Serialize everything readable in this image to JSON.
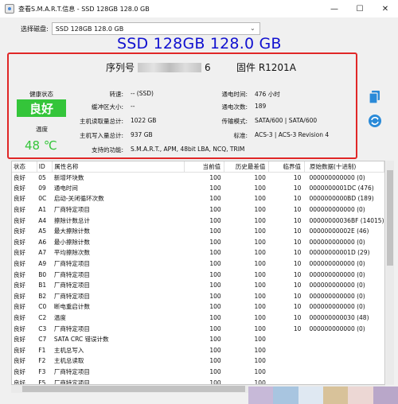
{
  "window": {
    "title": "查看S.M.A.R.T.信息 - SSD 128GB 128.0 GB",
    "minimize": "—",
    "maximize": "☐",
    "close": "✕"
  },
  "disk": {
    "label": "选择磁盘:",
    "selected": "SSD 128GB 128.0 GB"
  },
  "header_title": "SSD 128GB 128.0 GB",
  "info": {
    "serial_label": "序列号",
    "serial_suffix": "6",
    "firmware": "固件 R1201A",
    "health_label": "健康状态",
    "health_value": "良好",
    "temp_label": "温度",
    "temp_value": "48 ℃",
    "speed_label": "转速:",
    "speed_value": "-- (SSD)",
    "buffer_label": "缓冲区大小:",
    "buffer_value": "--",
    "host_read_label": "主机读取量总计:",
    "host_read_value": "1022 GB",
    "host_write_label": "主机写入量总计:",
    "host_write_value": "937 GB",
    "features_label": "支持的功能:",
    "features_value": "S.M.A.R.T., APM, 48bit LBA, NCQ, TRIM",
    "power_on_hours_label": "通电时间:",
    "power_on_hours_value": "476 小时",
    "power_count_label": "通电次数:",
    "power_count_value": "189",
    "transfer_label": "传输模式:",
    "transfer_value": "SATA/600 | SATA/600",
    "standard_label": "标准:",
    "standard_value": "ACS-3 | ACS-3 Revision 4"
  },
  "table": {
    "headers": [
      "状态",
      "ID",
      "属性名称",
      "当前值",
      "历史最差值",
      "临界值",
      "原始数据(十进制)"
    ],
    "rows": [
      [
        "良好",
        "05",
        "新增坏块数",
        "100",
        "100",
        "10",
        "000000000000 (0)"
      ],
      [
        "良好",
        "09",
        "通电时间",
        "100",
        "100",
        "10",
        "0000000001DC (476)"
      ],
      [
        "良好",
        "0C",
        "启动-关闭循环次数",
        "100",
        "100",
        "10",
        "0000000000BD (189)"
      ],
      [
        "良好",
        "A1",
        "厂商特定项目",
        "100",
        "100",
        "10",
        "000000000000 (0)"
      ],
      [
        "良好",
        "A4",
        "擦除计数总计",
        "100",
        "100",
        "10",
        "00000000036BF (14015)"
      ],
      [
        "良好",
        "A5",
        "最大擦除计数",
        "100",
        "100",
        "10",
        "00000000002E (46)"
      ],
      [
        "良好",
        "A6",
        "最小擦除计数",
        "100",
        "100",
        "10",
        "000000000000 (0)"
      ],
      [
        "良好",
        "A7",
        "平均擦除次数",
        "100",
        "100",
        "10",
        "00000000001D (29)"
      ],
      [
        "良好",
        "A9",
        "厂商特定项目",
        "100",
        "100",
        "10",
        "000000000000 (0)"
      ],
      [
        "良好",
        "B0",
        "厂商特定项目",
        "100",
        "100",
        "10",
        "000000000000 (0)"
      ],
      [
        "良好",
        "B1",
        "厂商特定项目",
        "100",
        "100",
        "10",
        "000000000000 (0)"
      ],
      [
        "良好",
        "B2",
        "厂商特定项目",
        "100",
        "100",
        "10",
        "000000000000 (0)"
      ],
      [
        "良好",
        "C0",
        "断电重启计数",
        "100",
        "100",
        "10",
        "000000000000 (0)"
      ],
      [
        "良好",
        "C2",
        "温度",
        "100",
        "100",
        "10",
        "000000000030 (48)"
      ],
      [
        "良好",
        "C3",
        "厂商特定项目",
        "100",
        "100",
        "10",
        "000000000000 (0)"
      ],
      [
        "良好",
        "C7",
        "SATA CRC 错误计数",
        "100",
        "100",
        "",
        ""
      ],
      [
        "良好",
        "F1",
        "主机总写入",
        "100",
        "100",
        "",
        ""
      ],
      [
        "良好",
        "F2",
        "主机总读取",
        "100",
        "100",
        "",
        ""
      ],
      [
        "良好",
        "F3",
        "厂商特定项目",
        "100",
        "100",
        "",
        ""
      ],
      [
        "良好",
        "F5",
        "厂商特定项目",
        "100",
        "100",
        "",
        ""
      ]
    ]
  },
  "colors": {
    "highlight_border": "#e02727",
    "health_green": "#34c53a",
    "title_blue": "#1010d0",
    "icon_blue": "#2a8ad8"
  },
  "icons": {
    "copy": "copy-icon",
    "refresh": "refresh-icon"
  }
}
